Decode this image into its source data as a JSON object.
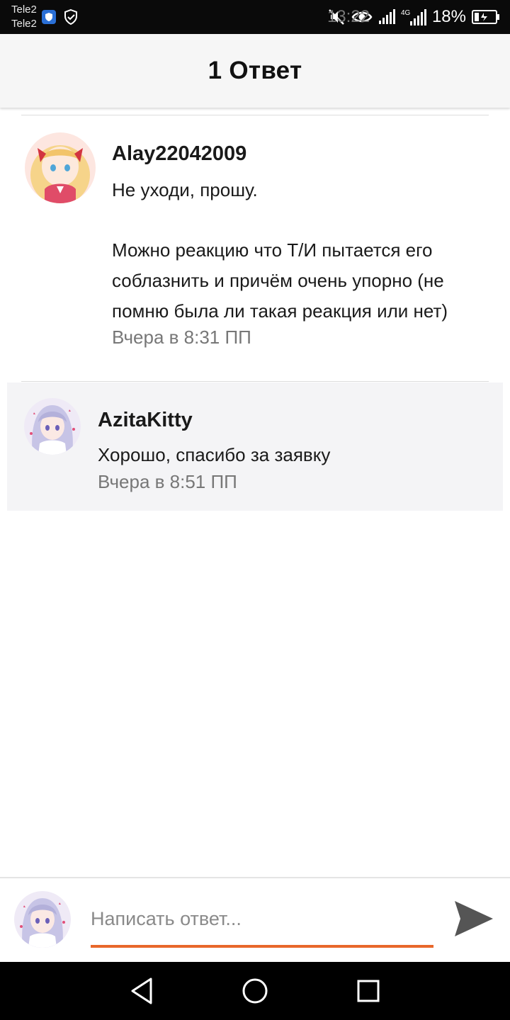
{
  "status_bar": {
    "carrier_1": "Tele2",
    "carrier_2": "Tele2",
    "network": "4G",
    "battery": "18%",
    "time": "13:22"
  },
  "header": {
    "title": "1 Ответ"
  },
  "comments": [
    {
      "author": "Alay22042009",
      "text_line1": "Не уходи, прошу.",
      "text_lines": [
        "Можно реакцию что Т/И пытается его",
        "соблазнить и причём очень упорно (не",
        "помню была ли такая реакция или нет)"
      ],
      "time": "Вчера в 8:31 ПП"
    },
    {
      "author": "AzitaKitty",
      "text": "Хорошо, спасибо за заявку",
      "time": "Вчера в 8:51 ПП"
    }
  ],
  "composer": {
    "placeholder": "Написать ответ..."
  },
  "colors": {
    "accent": "#e8672a",
    "reply_bg": "#f4f4f6",
    "header_bg": "#f6f6f6"
  },
  "icons": {
    "status": [
      "shield-icon",
      "check-shield-icon",
      "mute-icon",
      "eye-icon",
      "signal-icon",
      "battery-icon"
    ],
    "nav": [
      "back-icon",
      "home-icon",
      "recents-icon"
    ],
    "send": "send-icon"
  }
}
